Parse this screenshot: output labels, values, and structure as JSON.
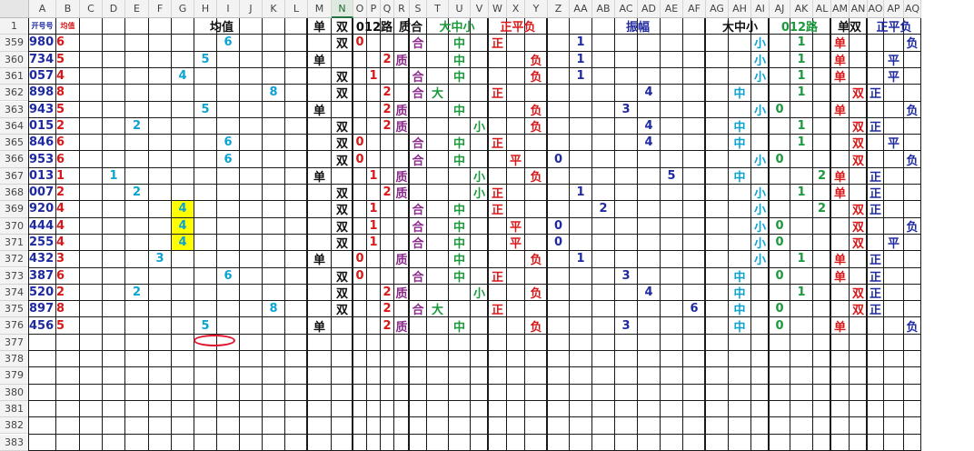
{
  "sheet": {
    "selected_column": "N",
    "columns": [
      "A",
      "B",
      "C",
      "D",
      "E",
      "F",
      "G",
      "H",
      "I",
      "J",
      "K",
      "L",
      "M",
      "N",
      "O",
      "P",
      "Q",
      "R",
      "S",
      "T",
      "U",
      "V",
      "W",
      "X",
      "Y",
      "Z",
      "AA",
      "AB",
      "AC",
      "AD",
      "AE",
      "AF",
      "AG",
      "AH",
      "AI",
      "AJ",
      "AK",
      "AL",
      "AM",
      "AN",
      "AO",
      "AP",
      "AQ"
    ],
    "header_row_number": "1",
    "header_a": "开号号",
    "header_b": "均值",
    "group_headers": [
      {
        "label": "均值",
        "col": "G"
      },
      {
        "label": "单",
        "col": "M"
      },
      {
        "label": "双",
        "col": "N"
      },
      {
        "label": "012路",
        "col": "O"
      },
      {
        "label": "质合",
        "col": "R"
      },
      {
        "label": "大中小",
        "col": "T"
      },
      {
        "label": "正平负",
        "col": "W"
      },
      {
        "label": "振幅",
        "col": "AA"
      },
      {
        "label": "大中小",
        "col": "AG"
      },
      {
        "label": "012路",
        "col": "AJ"
      },
      {
        "label": "单双",
        "col": "AM"
      },
      {
        "label": "正平负",
        "col": "AO"
      }
    ],
    "rows": [
      {
        "num": "359",
        "A": "980",
        "B": "6",
        "cells": [
          [
            "I",
            "6",
            "c"
          ],
          [
            "N",
            "双",
            "k"
          ],
          [
            "O",
            "0",
            "r"
          ],
          [
            "S",
            "合",
            "p"
          ],
          [
            "U",
            "中",
            "g"
          ],
          [
            "W",
            "正",
            "r"
          ],
          [
            "AA",
            "1",
            "n"
          ],
          [
            "AI",
            "小",
            "c"
          ],
          [
            "AK",
            "1",
            "g"
          ],
          [
            "AM",
            "单",
            "r"
          ],
          [
            "AQ",
            "负",
            "n"
          ]
        ]
      },
      {
        "num": "360",
        "A": "734",
        "B": "5",
        "cells": [
          [
            "H",
            "5",
            "c"
          ],
          [
            "M",
            "单",
            "k"
          ],
          [
            "Q",
            "2",
            "r"
          ],
          [
            "R",
            "质",
            "p"
          ],
          [
            "U",
            "中",
            "g"
          ],
          [
            "Y",
            "负",
            "r"
          ],
          [
            "AA",
            "1",
            "n"
          ],
          [
            "AI",
            "小",
            "c"
          ],
          [
            "AK",
            "1",
            "g"
          ],
          [
            "AM",
            "单",
            "r"
          ],
          [
            "AP",
            "平",
            "n"
          ]
        ]
      },
      {
        "num": "361",
        "A": "057",
        "B": "4",
        "cells": [
          [
            "G",
            "4",
            "c"
          ],
          [
            "N",
            "双",
            "k"
          ],
          [
            "P",
            "1",
            "r"
          ],
          [
            "S",
            "合",
            "p"
          ],
          [
            "U",
            "中",
            "g"
          ],
          [
            "Y",
            "负",
            "r"
          ],
          [
            "AA",
            "1",
            "n"
          ],
          [
            "AI",
            "小",
            "c"
          ],
          [
            "AK",
            "1",
            "g"
          ],
          [
            "AM",
            "单",
            "r"
          ],
          [
            "AP",
            "平",
            "n"
          ]
        ]
      },
      {
        "num": "362",
        "A": "898",
        "B": "8",
        "cells": [
          [
            "K",
            "8",
            "c"
          ],
          [
            "N",
            "双",
            "k"
          ],
          [
            "Q",
            "2",
            "r"
          ],
          [
            "S",
            "合",
            "p"
          ],
          [
            "T",
            "大",
            "g"
          ],
          [
            "W",
            "正",
            "r"
          ],
          [
            "AD",
            "4",
            "n"
          ],
          [
            "AH",
            "中",
            "c"
          ],
          [
            "AK",
            "1",
            "g"
          ],
          [
            "AN",
            "双",
            "r"
          ],
          [
            "AO",
            "正",
            "n"
          ]
        ]
      },
      {
        "num": "363",
        "A": "943",
        "B": "5",
        "cells": [
          [
            "H",
            "5",
            "c"
          ],
          [
            "M",
            "单",
            "k"
          ],
          [
            "Q",
            "2",
            "r"
          ],
          [
            "R",
            "质",
            "p"
          ],
          [
            "U",
            "中",
            "g"
          ],
          [
            "Y",
            "负",
            "r"
          ],
          [
            "AC",
            "3",
            "n"
          ],
          [
            "AI",
            "小",
            "c"
          ],
          [
            "AJ",
            "0",
            "g"
          ],
          [
            "AM",
            "单",
            "r"
          ],
          [
            "AQ",
            "负",
            "n"
          ]
        ]
      },
      {
        "num": "364",
        "A": "015",
        "B": "2",
        "cells": [
          [
            "E",
            "2",
            "c"
          ],
          [
            "N",
            "双",
            "k"
          ],
          [
            "Q",
            "2",
            "r"
          ],
          [
            "R",
            "质",
            "p"
          ],
          [
            "V",
            "小",
            "g"
          ],
          [
            "Y",
            "负",
            "r"
          ],
          [
            "AD",
            "4",
            "n"
          ],
          [
            "AH",
            "中",
            "c"
          ],
          [
            "AK",
            "1",
            "g"
          ],
          [
            "AN",
            "双",
            "r"
          ],
          [
            "AO",
            "正",
            "n"
          ]
        ]
      },
      {
        "num": "365",
        "A": "846",
        "B": "6",
        "cells": [
          [
            "I",
            "6",
            "c"
          ],
          [
            "N",
            "双",
            "k"
          ],
          [
            "O",
            "0",
            "r"
          ],
          [
            "S",
            "合",
            "p"
          ],
          [
            "U",
            "中",
            "g"
          ],
          [
            "W",
            "正",
            "r"
          ],
          [
            "AD",
            "4",
            "n"
          ],
          [
            "AH",
            "中",
            "c"
          ],
          [
            "AK",
            "1",
            "g"
          ],
          [
            "AN",
            "双",
            "r"
          ],
          [
            "AP",
            "平",
            "n"
          ]
        ]
      },
      {
        "num": "366",
        "A": "953",
        "B": "6",
        "cells": [
          [
            "I",
            "6",
            "c"
          ],
          [
            "N",
            "双",
            "k"
          ],
          [
            "O",
            "0",
            "r"
          ],
          [
            "S",
            "合",
            "p"
          ],
          [
            "U",
            "中",
            "g"
          ],
          [
            "X",
            "平",
            "r"
          ],
          [
            "Z",
            "0",
            "n"
          ],
          [
            "AI",
            "小",
            "c"
          ],
          [
            "AJ",
            "0",
            "g"
          ],
          [
            "AN",
            "双",
            "r"
          ],
          [
            "AQ",
            "负",
            "n"
          ]
        ]
      },
      {
        "num": "367",
        "A": "013",
        "B": "1",
        "cells": [
          [
            "D",
            "1",
            "c"
          ],
          [
            "M",
            "单",
            "k"
          ],
          [
            "P",
            "1",
            "r"
          ],
          [
            "R",
            "质",
            "p"
          ],
          [
            "V",
            "小",
            "g"
          ],
          [
            "Y",
            "负",
            "r"
          ],
          [
            "AE",
            "5",
            "n"
          ],
          [
            "AH",
            "中",
            "c"
          ],
          [
            "AL",
            "2",
            "g"
          ],
          [
            "AM",
            "单",
            "r"
          ],
          [
            "AO",
            "正",
            "n"
          ]
        ]
      },
      {
        "num": "368",
        "A": "007",
        "B": "2",
        "cells": [
          [
            "E",
            "2",
            "c"
          ],
          [
            "N",
            "双",
            "k"
          ],
          [
            "Q",
            "2",
            "r"
          ],
          [
            "R",
            "质",
            "p"
          ],
          [
            "V",
            "小",
            "g"
          ],
          [
            "W",
            "正",
            "r"
          ],
          [
            "AA",
            "1",
            "n"
          ],
          [
            "AI",
            "小",
            "c"
          ],
          [
            "AK",
            "1",
            "g"
          ],
          [
            "AM",
            "单",
            "r"
          ],
          [
            "AO",
            "正",
            "n"
          ]
        ]
      },
      {
        "num": "369",
        "A": "920",
        "B": "4",
        "cells": [
          [
            "G",
            "4",
            "c",
            "hl"
          ],
          [
            "N",
            "双",
            "k"
          ],
          [
            "P",
            "1",
            "r"
          ],
          [
            "S",
            "合",
            "p"
          ],
          [
            "U",
            "中",
            "g"
          ],
          [
            "W",
            "正",
            "r"
          ],
          [
            "AB",
            "2",
            "n"
          ],
          [
            "AI",
            "小",
            "c"
          ],
          [
            "AL",
            "2",
            "g"
          ],
          [
            "AN",
            "双",
            "r"
          ],
          [
            "AO",
            "正",
            "n"
          ]
        ]
      },
      {
        "num": "370",
        "A": "444",
        "B": "4",
        "cells": [
          [
            "G",
            "4",
            "c",
            "hl"
          ],
          [
            "N",
            "双",
            "k"
          ],
          [
            "P",
            "1",
            "r"
          ],
          [
            "S",
            "合",
            "p"
          ],
          [
            "U",
            "中",
            "g"
          ],
          [
            "X",
            "平",
            "r"
          ],
          [
            "Z",
            "0",
            "n"
          ],
          [
            "AI",
            "小",
            "c"
          ],
          [
            "AJ",
            "0",
            "g"
          ],
          [
            "AN",
            "双",
            "r"
          ],
          [
            "AQ",
            "负",
            "n"
          ]
        ]
      },
      {
        "num": "371",
        "A": "255",
        "B": "4",
        "cells": [
          [
            "G",
            "4",
            "c",
            "hl"
          ],
          [
            "N",
            "双",
            "k"
          ],
          [
            "P",
            "1",
            "r"
          ],
          [
            "S",
            "合",
            "p"
          ],
          [
            "U",
            "中",
            "g"
          ],
          [
            "X",
            "平",
            "r"
          ],
          [
            "Z",
            "0",
            "n"
          ],
          [
            "AI",
            "小",
            "c"
          ],
          [
            "AJ",
            "0",
            "g"
          ],
          [
            "AN",
            "双",
            "r"
          ],
          [
            "AP",
            "平",
            "n"
          ]
        ]
      },
      {
        "num": "372",
        "A": "432",
        "B": "3",
        "cells": [
          [
            "F",
            "3",
            "c"
          ],
          [
            "M",
            "单",
            "k"
          ],
          [
            "O",
            "0",
            "r"
          ],
          [
            "R",
            "质",
            "p"
          ],
          [
            "U",
            "中",
            "g"
          ],
          [
            "Y",
            "负",
            "r"
          ],
          [
            "AA",
            "1",
            "n"
          ],
          [
            "AI",
            "小",
            "c"
          ],
          [
            "AK",
            "1",
            "g"
          ],
          [
            "AM",
            "单",
            "r"
          ],
          [
            "AO",
            "正",
            "n"
          ]
        ]
      },
      {
        "num": "373",
        "A": "387",
        "B": "6",
        "cells": [
          [
            "I",
            "6",
            "c"
          ],
          [
            "N",
            "双",
            "k"
          ],
          [
            "O",
            "0",
            "r"
          ],
          [
            "S",
            "合",
            "p"
          ],
          [
            "U",
            "中",
            "g"
          ],
          [
            "W",
            "正",
            "r"
          ],
          [
            "AC",
            "3",
            "n"
          ],
          [
            "AH",
            "中",
            "c"
          ],
          [
            "AJ",
            "0",
            "g"
          ],
          [
            "AM",
            "单",
            "r"
          ],
          [
            "AO",
            "正",
            "n"
          ]
        ]
      },
      {
        "num": "374",
        "A": "520",
        "B": "2",
        "cells": [
          [
            "E",
            "2",
            "c"
          ],
          [
            "N",
            "双",
            "k"
          ],
          [
            "Q",
            "2",
            "r"
          ],
          [
            "R",
            "质",
            "p"
          ],
          [
            "V",
            "小",
            "g"
          ],
          [
            "Y",
            "负",
            "r"
          ],
          [
            "AD",
            "4",
            "n"
          ],
          [
            "AH",
            "中",
            "c"
          ],
          [
            "AK",
            "1",
            "g"
          ],
          [
            "AN",
            "双",
            "r"
          ],
          [
            "AO",
            "正",
            "n"
          ]
        ]
      },
      {
        "num": "375",
        "A": "897",
        "B": "8",
        "cells": [
          [
            "K",
            "8",
            "c"
          ],
          [
            "N",
            "双",
            "k"
          ],
          [
            "Q",
            "2",
            "r"
          ],
          [
            "S",
            "合",
            "p"
          ],
          [
            "T",
            "大",
            "g"
          ],
          [
            "W",
            "正",
            "r"
          ],
          [
            "AF",
            "6",
            "n"
          ],
          [
            "AH",
            "中",
            "c"
          ],
          [
            "AJ",
            "0",
            "g"
          ],
          [
            "AN",
            "双",
            "r"
          ],
          [
            "AO",
            "正",
            "n"
          ]
        ]
      },
      {
        "num": "376",
        "A": "456",
        "B": "5",
        "cells": [
          [
            "H",
            "5",
            "c"
          ],
          [
            "M",
            "单",
            "k"
          ],
          [
            "Q",
            "2",
            "r"
          ],
          [
            "R",
            "质",
            "p"
          ],
          [
            "U",
            "中",
            "g"
          ],
          [
            "Y",
            "负",
            "r"
          ],
          [
            "AC",
            "3",
            "n"
          ],
          [
            "AH",
            "中",
            "c"
          ],
          [
            "AJ",
            "0",
            "g"
          ],
          [
            "AM",
            "单",
            "r"
          ],
          [
            "AQ",
            "负",
            "n"
          ]
        ]
      }
    ],
    "empty_rows": [
      "377",
      "378",
      "379",
      "380",
      "381",
      "382",
      "383"
    ]
  },
  "colors": {
    "navy": "#1f2aa0",
    "red": "#d81818",
    "cyan": "#0aa3d4",
    "purple": "#8b2a8b",
    "green": "#1a9a3a",
    "black": "#111111",
    "highlight": "#ffff00",
    "annotation": "#e0102a"
  }
}
